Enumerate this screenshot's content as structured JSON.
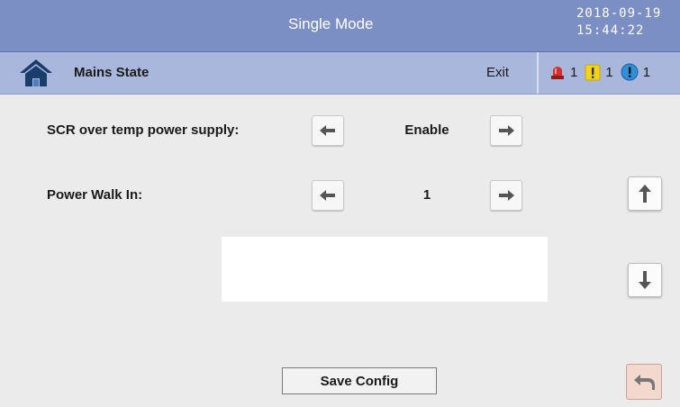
{
  "header": {
    "title": "Single Mode",
    "date": "2018-09-19",
    "time": "15:44:22"
  },
  "subbar": {
    "home_icon": "home-icon",
    "breadcrumb": "Mains State",
    "exit_label": "Exit",
    "alarms": [
      {
        "icon": "red-alarm-icon",
        "count": "1",
        "color": "#c62828"
      },
      {
        "icon": "yellow-warning-icon",
        "count": "1",
        "color": "#f2d21c"
      },
      {
        "icon": "blue-info-icon",
        "count": "1",
        "color": "#2f8fd8"
      }
    ]
  },
  "settings": [
    {
      "label": "SCR over temp power supply:",
      "value": "Enable"
    },
    {
      "label": "Power Walk In:",
      "value": "1"
    }
  ],
  "actions": {
    "save_label": "Save Config"
  },
  "colors": {
    "titlebar": "#7b8fc4",
    "subbar": "#a9b7dd",
    "background": "#ebebeb",
    "back_button": "#f3d8ce"
  }
}
